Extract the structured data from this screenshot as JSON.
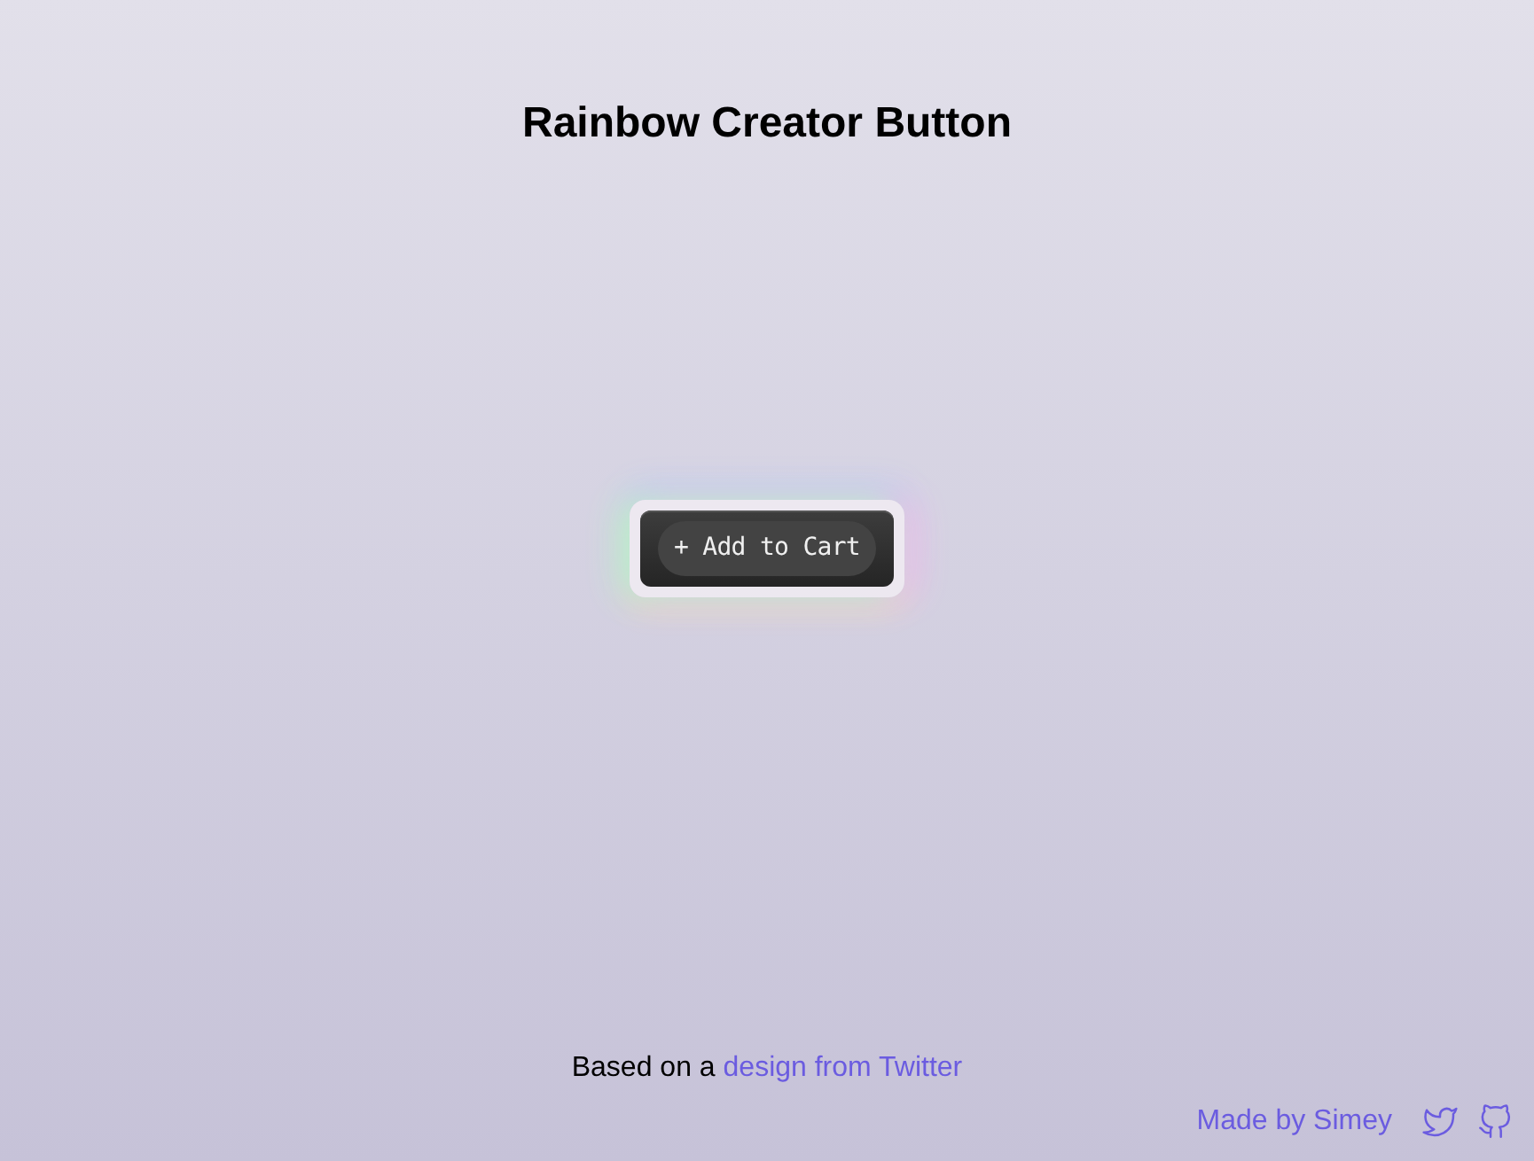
{
  "title": "Rainbow Creator Button",
  "button": {
    "label": "+ Add to Cart"
  },
  "credit": {
    "text": "Based on a ",
    "link": "design from Twitter"
  },
  "footer": {
    "author": "Made by Simey"
  }
}
